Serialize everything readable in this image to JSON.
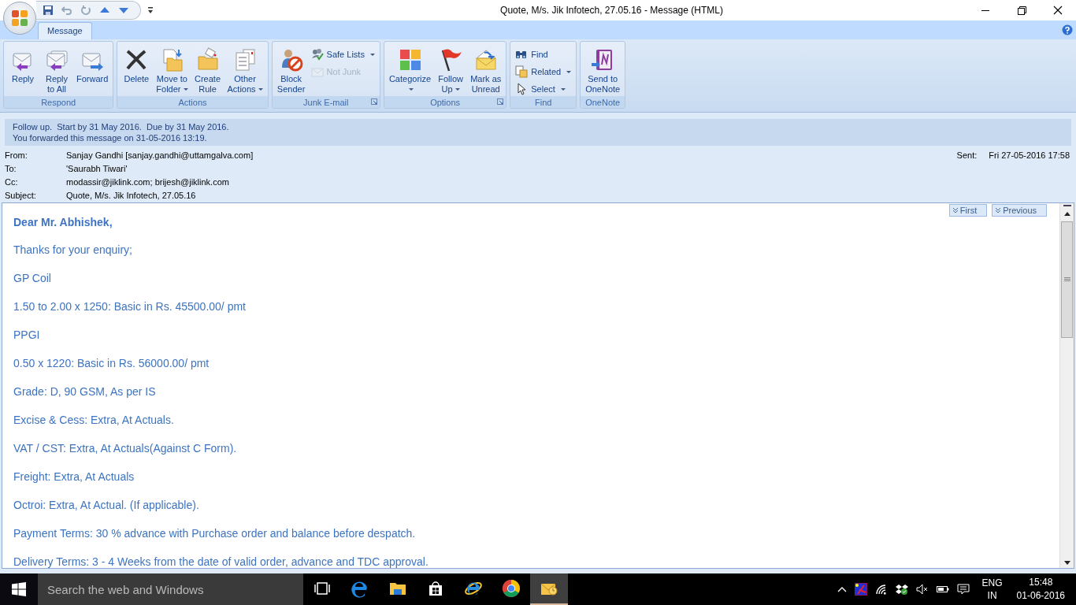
{
  "window": {
    "title": "Quote, M/s. Jik Infotech, 27.05.16 - Message (HTML)"
  },
  "tabs": [
    {
      "label": "Message",
      "selected": true
    }
  ],
  "ribbon": {
    "groups": [
      {
        "label": "Respond",
        "launcher": false,
        "buttons": [
          {
            "kind": "large",
            "lines": [
              "Reply"
            ],
            "dropdown": false,
            "disabled": false
          },
          {
            "kind": "large",
            "lines": [
              "Reply",
              "to All"
            ],
            "dropdown": false,
            "disabled": false
          },
          {
            "kind": "large",
            "lines": [
              "Forward"
            ],
            "dropdown": false,
            "disabled": false
          }
        ]
      },
      {
        "label": "Actions",
        "launcher": false,
        "buttons": [
          {
            "kind": "large",
            "lines": [
              "Delete"
            ],
            "dropdown": false,
            "disabled": false
          },
          {
            "kind": "large",
            "lines": [
              "Move to",
              "Folder"
            ],
            "dropdown": true,
            "disabled": false
          },
          {
            "kind": "large",
            "lines": [
              "Create",
              "Rule"
            ],
            "dropdown": false,
            "disabled": false
          },
          {
            "kind": "large",
            "lines": [
              "Other",
              "Actions"
            ],
            "dropdown": true,
            "disabled": false
          }
        ]
      },
      {
        "label": "Junk E-mail",
        "launcher": true,
        "buttons": [
          {
            "kind": "large",
            "lines": [
              "Block",
              "Sender"
            ],
            "dropdown": false,
            "disabled": false
          },
          {
            "kind": "small",
            "lines": [
              "Safe Lists"
            ],
            "dropdown": true,
            "disabled": false
          },
          {
            "kind": "small",
            "lines": [
              "Not Junk"
            ],
            "dropdown": false,
            "disabled": true
          }
        ]
      },
      {
        "label": "Options",
        "launcher": true,
        "buttons": [
          {
            "kind": "large",
            "lines": [
              "Categorize"
            ],
            "dropdown": true,
            "disabled": false
          },
          {
            "kind": "large",
            "lines": [
              "Follow",
              "Up"
            ],
            "dropdown": true,
            "disabled": false
          },
          {
            "kind": "large",
            "lines": [
              "Mark as",
              "Unread"
            ],
            "dropdown": false,
            "disabled": false
          }
        ]
      },
      {
        "label": "Find",
        "launcher": false,
        "buttons": [
          {
            "kind": "small",
            "lines": [
              "Find"
            ],
            "dropdown": false,
            "disabled": false
          },
          {
            "kind": "small",
            "lines": [
              "Related"
            ],
            "dropdown": true,
            "disabled": false
          },
          {
            "kind": "small",
            "lines": [
              "Select"
            ],
            "dropdown": true,
            "disabled": false
          }
        ]
      },
      {
        "label": "OneNote",
        "launcher": false,
        "buttons": [
          {
            "kind": "large",
            "lines": [
              "Send to",
              "OneNote"
            ],
            "dropdown": false,
            "disabled": false
          }
        ]
      }
    ]
  },
  "infobar": [
    "Follow up.  Start by 31 May 2016.  Due by 31 May 2016.",
    "You forwarded this message on 31-05-2016 13:19."
  ],
  "headers": [
    {
      "label": "From:",
      "value": "Sanjay Gandhi [sanjay.gandhi@uttamgalva.com]"
    },
    {
      "label": "To:",
      "value": "'Saurabh Tiwari'"
    },
    {
      "label": "Cc:",
      "value": "modassir@jiklink.com; brijesh@jiklink.com"
    },
    {
      "label": "Subject:",
      "value": "Quote, M/s. Jik Infotech, 27.05.16"
    }
  ],
  "sent": {
    "label": "Sent:",
    "value": "Fri 27-05-2016 17:58"
  },
  "nav_buttons": [
    "First",
    "Previous"
  ],
  "body": [
    {
      "text": "Dear Mr. Abhishek,",
      "bold": true
    },
    {
      "text": "Thanks for your enquiry;",
      "bold": false
    },
    {
      "text": "GP Coil",
      "bold": false
    },
    {
      "text": "1.50 to 2.00 x 1250: Basic in Rs. 45500.00/ pmt",
      "bold": false
    },
    {
      "text": "PPGI",
      "bold": false
    },
    {
      "text": "0.50 x 1220: Basic in Rs. 56000.00/ pmt",
      "bold": false
    },
    {
      "text": "Grade: D, 90 GSM, As per IS",
      "bold": false
    },
    {
      "text": "Excise & Cess: Extra, At Actuals.",
      "bold": false
    },
    {
      "text": "VAT / CST: Extra, At Actuals(Against C Form).",
      "bold": false
    },
    {
      "text": "Freight: Extra, At Actuals",
      "bold": false
    },
    {
      "text": "Octroi: Extra, At Actual. (If applicable).",
      "bold": false
    },
    {
      "text": "Payment Terms: 30 % advance with Purchase order and balance before despatch.",
      "bold": false
    },
    {
      "text": "Delivery Terms:  3 - 4 Weeks from the date of valid order, advance and TDC approval.",
      "bold": false
    }
  ],
  "taskbar": {
    "search": {
      "placeholder": "Search the web and Windows"
    },
    "apps": [
      {
        "selected": false
      },
      {
        "selected": false
      },
      {
        "selected": false
      },
      {
        "selected": false
      },
      {
        "selected": false
      },
      {
        "selected": false
      },
      {
        "selected": true
      }
    ],
    "language": [
      "ENG",
      "IN"
    ],
    "time": "15:48",
    "date": "01-06-2016"
  }
}
